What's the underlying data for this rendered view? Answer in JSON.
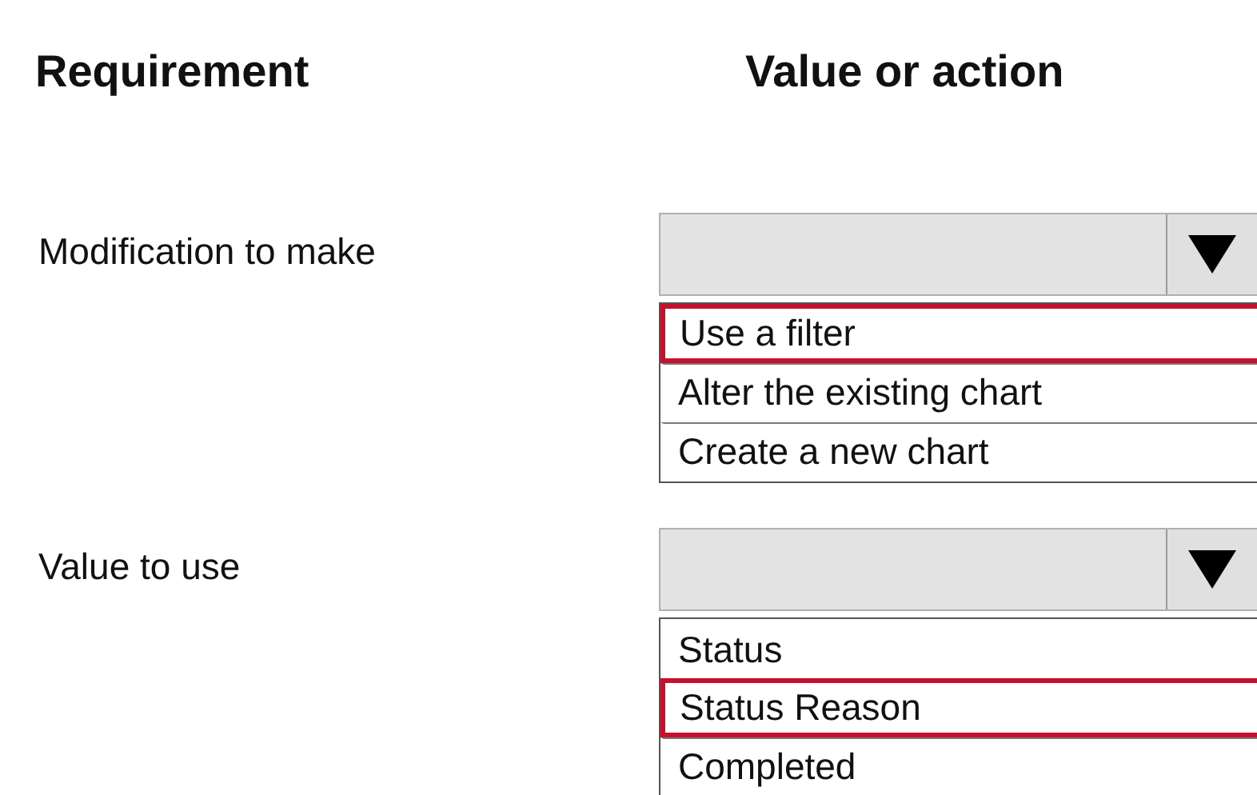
{
  "headers": {
    "requirement": "Requirement",
    "value": "Value or action"
  },
  "rows": [
    {
      "label": "Modification to make",
      "options": [
        {
          "text": "Use a filter",
          "selected": true
        },
        {
          "text": "Alter the existing chart",
          "selected": false
        },
        {
          "text": "Create a new chart",
          "selected": false
        }
      ]
    },
    {
      "label": "Value to use",
      "options": [
        {
          "text": "Status",
          "selected": false
        },
        {
          "text": "Status Reason",
          "selected": true
        },
        {
          "text": "Completed",
          "selected": false
        }
      ]
    }
  ]
}
